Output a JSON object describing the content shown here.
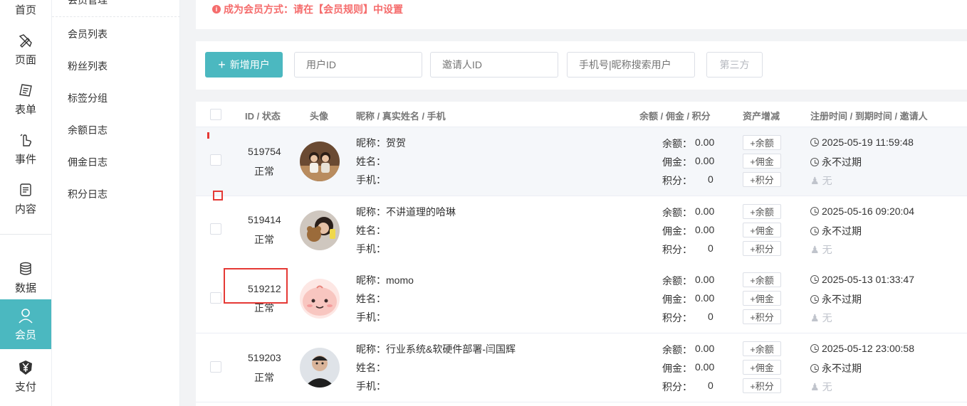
{
  "nav": {
    "items": [
      {
        "label": "首页",
        "icon": "home-icon"
      },
      {
        "label": "页面",
        "icon": "pencil-ruler-icon"
      },
      {
        "label": "表单",
        "icon": "form-icon"
      },
      {
        "label": "事件",
        "icon": "pointer-icon"
      },
      {
        "label": "内容",
        "icon": "document-icon"
      },
      {
        "label": "数据",
        "icon": "database-icon"
      },
      {
        "label": "会员",
        "icon": "user-icon"
      },
      {
        "label": "支付",
        "icon": "yen-icon"
      }
    ],
    "active": "会员"
  },
  "submenu": {
    "head": "会员管理",
    "items": [
      "会员列表",
      "粉丝列表",
      "标签分组",
      "余额日志",
      "佣金日志",
      "积分日志"
    ]
  },
  "notice": {
    "text": "成为会员方式：请在【会员规则】中设置"
  },
  "toolbar": {
    "add_button": "新增用户",
    "user_id_placeholder": "用户ID",
    "inviter_placeholder": "邀请人ID",
    "phone_placeholder": "手机号|昵称搜索用户",
    "third_party_button": "第三方"
  },
  "table": {
    "headers": {
      "id_status": "ID / 状态",
      "avatar": "头像",
      "name": "昵称 / 真实姓名 / 手机",
      "finance": "余额 / 佣金 / 积分",
      "asset": "资产增减",
      "time": "注册时间 / 到期时间 / 邀请人"
    },
    "labels": {
      "nickname": "昵称：",
      "realname": "姓名：",
      "phone": "手机：",
      "balance": "余额：",
      "commission": "佣金：",
      "points": "积分：",
      "add_balance": "+余额",
      "add_commission": "+佣金",
      "add_points": "+积分"
    },
    "rows": [
      {
        "id": "519754",
        "status": "正常",
        "nickname": "贺贺",
        "balance": "0.00",
        "commission": "0.00",
        "points": "0",
        "register": "2025-05-19 11:59:48",
        "expire": "永不过期",
        "inviter": "无"
      },
      {
        "id": "519414",
        "status": "正常",
        "nickname": "不讲道理的哈琳",
        "balance": "0.00",
        "commission": "0.00",
        "points": "0",
        "register": "2025-05-16 09:20:04",
        "expire": "永不过期",
        "inviter": "无"
      },
      {
        "id": "519212",
        "status": "正常",
        "nickname": "momo",
        "balance": "0.00",
        "commission": "0.00",
        "points": "0",
        "register": "2025-05-13 01:33:47",
        "expire": "永不过期",
        "inviter": "无"
      },
      {
        "id": "519203",
        "status": "正常",
        "nickname": "行业系统&软硬件部署-闫国辉",
        "balance": "0.00",
        "commission": "0.00",
        "points": "0",
        "register": "2025-05-12 23:00:58",
        "expire": "永不过期",
        "inviter": "无"
      }
    ]
  },
  "colors": {
    "accent": "#4bb8c0",
    "warning": "#f56c6c",
    "highlight_box": "#e53935"
  }
}
